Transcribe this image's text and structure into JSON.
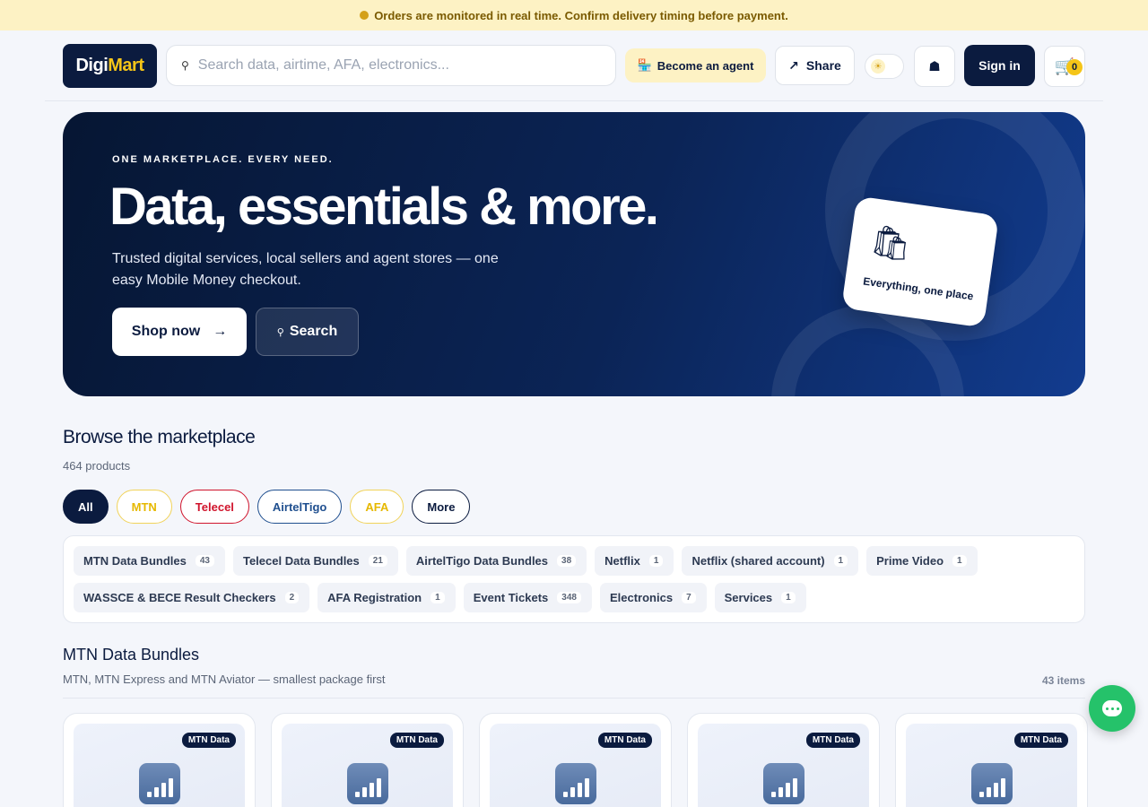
{
  "banner": {
    "text": "Orders are monitored in real time. Confirm delivery timing before payment."
  },
  "header": {
    "logo": {
      "part1": "Digi",
      "part2": "Mart"
    },
    "search_placeholder": "Search data, airtime, AFA, electronics...",
    "agent_label": "Become an agent",
    "share_label": "Share",
    "signin_label": "Sign in",
    "cart_count": "0"
  },
  "hero": {
    "eyebrow": "ONE MARKETPLACE. EVERY NEED.",
    "headline": "Data, essentials & more.",
    "subtitle": "Trusted digital services, local sellers and agent stores — one easy Mobile Money checkout.",
    "shop_label": "Shop now",
    "search_label": "Search",
    "card_label": "Everything, one place"
  },
  "browse": {
    "title": "Browse the marketplace",
    "count": "464 products",
    "chips": [
      {
        "label": "All",
        "color": "#0b1b3f"
      },
      {
        "label": "MTN",
        "color": "#e6b800"
      },
      {
        "label": "Telecel",
        "color": "#d0142c"
      },
      {
        "label": "AirtelTigo",
        "color": "#1f4f8f"
      },
      {
        "label": "AFA",
        "color": "#e6b800"
      },
      {
        "label": "More",
        "color": "#0b1b3f"
      }
    ],
    "categories": [
      {
        "name": "MTN Data Bundles",
        "count": "43"
      },
      {
        "name": "Telecel Data Bundles",
        "count": "21"
      },
      {
        "name": "AirtelTigo Data Bundles",
        "count": "38"
      },
      {
        "name": "Netflix",
        "count": "1"
      },
      {
        "name": "Netflix (shared account)",
        "count": "1"
      },
      {
        "name": "Prime Video",
        "count": "1"
      },
      {
        "name": "WASSCE & BECE Result Checkers",
        "count": "2"
      },
      {
        "name": "AFA Registration",
        "count": "1"
      },
      {
        "name": "Event Tickets",
        "count": "348"
      },
      {
        "name": "Electronics",
        "count": "7"
      },
      {
        "name": "Services",
        "count": "1"
      }
    ]
  },
  "section": {
    "title": "MTN Data Bundles",
    "subtitle": "MTN, MTN Express and MTN Aviator — smallest package first",
    "count": "43 items",
    "products": [
      {
        "badge": "MTN Data"
      },
      {
        "badge": "MTN Data"
      },
      {
        "badge": "MTN Data"
      },
      {
        "badge": "MTN Data"
      },
      {
        "badge": "MTN Data"
      }
    ]
  },
  "icons": {
    "banner": "status-dot-icon",
    "search": "search-icon",
    "agent": "store-icon",
    "share": "arrow-up-right-icon",
    "theme": "sun-icon",
    "install": "install-icon",
    "cart": "cart-icon",
    "shop": "arrow-right-icon",
    "hero_card": "shopping-bags-icon",
    "product": "signal-bars-icon",
    "chat": "chat-icon"
  }
}
